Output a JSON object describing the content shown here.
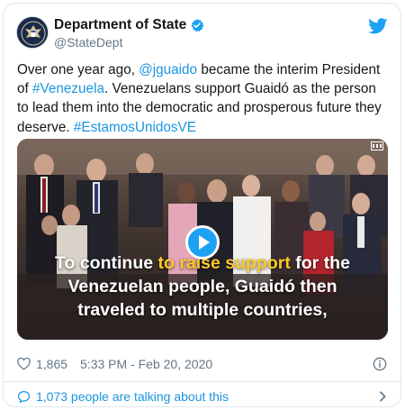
{
  "account": {
    "display_name": "Department of State",
    "handle": "@StateDept"
  },
  "tweet": {
    "t1": "Over one year ago, ",
    "mention": "@jguaido",
    "t2": " became the interim President of ",
    "hashtag1": "#Venezuela",
    "t3": ". Venezuelans support Guaidó as the person to lead them into the democratic and prosperous future they deserve. ",
    "hashtag2": "#EstamosUnidosVE"
  },
  "video": {
    "caption_pre": "To continue ",
    "caption_highlight": "to raise support",
    "caption_post1": " for the",
    "caption_line2": "Venezuelan people, Guaidó then",
    "caption_line3": "traveled to multiple countries,"
  },
  "meta": {
    "likes": "1,865",
    "timestamp": "5:33 PM - Feb 20, 2020"
  },
  "footer": {
    "talking": "1,073 people are talking about this"
  },
  "colors": {
    "link": "#1b95e0",
    "verified": "#1da1f2",
    "highlight": "#ffc828"
  },
  "icons": [
    "verified-badge-icon",
    "twitter-bird-icon",
    "play-icon",
    "heart-icon",
    "info-icon",
    "speech-bubble-icon",
    "chevron-right-icon"
  ]
}
